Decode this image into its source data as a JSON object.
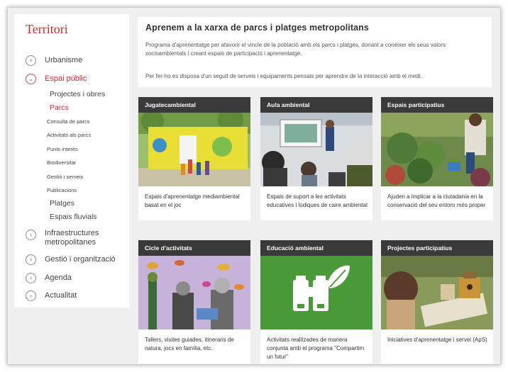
{
  "sidebar": {
    "title": "Territori",
    "items": [
      {
        "label": "Urbanisme",
        "toggle": "›"
      },
      {
        "label": "Espai públic",
        "toggle": "⌄"
      },
      {
        "label": "Infraestructures metropolitanes",
        "toggle": "›"
      },
      {
        "label": "Gestió i organització",
        "toggle": "›"
      },
      {
        "label": "Agenda",
        "toggle": "›"
      },
      {
        "label": "Actualitat",
        "toggle": "›"
      }
    ],
    "subitems": [
      "Projectes i obres",
      "Parcs",
      "Platges",
      "Espais fluvials"
    ],
    "parcs_subitems": [
      "Consulta de parcs",
      "Activitats als parcs",
      "Punts interès",
      "Biodiversitat",
      "Gestió i serveis",
      "Publicacions"
    ]
  },
  "intro": {
    "title": "Aprenem a la xarxa de parcs i platges metropolitans",
    "p1": "Programa d'aprenentatge per afavorir el vincle de la població amb els parcs i platges, donant a conèixer els seus valors socioambientals i creant espais de participació i aprenentatge.",
    "p2": "Per fer-ho es disposa d'un seguit de serveis i equipaments pensats per aprendre de la interacció amb el medi."
  },
  "cards": [
    {
      "title": "Jugatecambiental",
      "desc": "Espais d'aprenentatge mediambiental basat en el joc"
    },
    {
      "title": "Aula ambiental",
      "desc": "Espais de suport a les activitats educatives i lúdiques de caire ambiental"
    },
    {
      "title": "Espais participatius",
      "desc": "Ajuden a implicar a la ciutadania en la conservació del seu entorn més proper"
    },
    {
      "title": "Cicle d'activitats",
      "desc": "Tallers, visites guiades, itineraris de natura, jocs en família, etc."
    },
    {
      "title": "Educació ambiental",
      "desc": "Activitats realitzades de manera conjunta amb el programa \"Compartim un futur\""
    },
    {
      "title": "Projectes participatius",
      "desc": "Iniciatives d'aprenentatge i servei (ApS)"
    }
  ],
  "colors": {
    "accent": "#d22630",
    "card_header": "#3a3a3a",
    "education_green": "#4a9a3a"
  }
}
